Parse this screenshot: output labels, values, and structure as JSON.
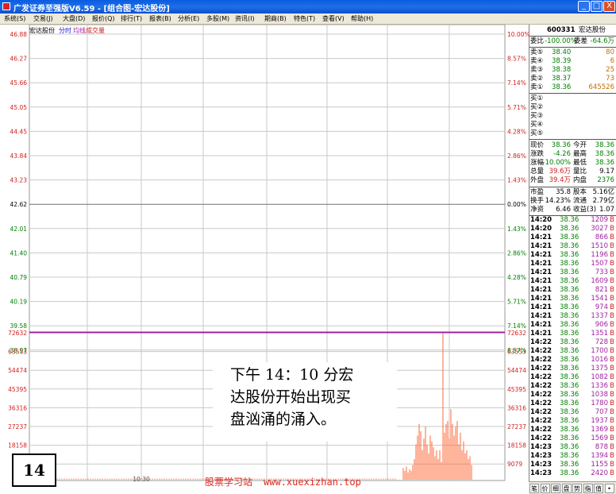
{
  "window": {
    "title": "广发证券至强版V6.59 - [组合图-宏达股份]",
    "buttons": [
      "_",
      "□",
      "X"
    ]
  },
  "menu": [
    "系统(S)",
    "交易(J)",
    "大盘(D)",
    "报价(Q)",
    "排行(T)",
    "报表(B)",
    "分析(E)",
    "多股(M)",
    "资讯(I)",
    "期商(B)",
    "特色(T)",
    "查看(V)",
    "帮助(H)"
  ],
  "chart_header": {
    "stock": "宏达股份",
    "tab": "分时",
    "avg": "均线",
    "vol": "成交量"
  },
  "price_axis_left": [
    "46.88",
    "46.27",
    "45.66",
    "45.05",
    "44.45",
    "43.84",
    "43.23",
    "42.62",
    "42.01",
    "41.40",
    "40.79",
    "40.19",
    "39.58",
    "38.97"
  ],
  "price_axis_right": [
    "10.00%",
    "8.57%",
    "7.14%",
    "5.71%",
    "4.28%",
    "2.86%",
    "1.43%",
    "0.00%",
    "1.43%",
    "2.86%",
    "4.28%",
    "5.71%",
    "7.14%",
    "8.57%"
  ],
  "volume_axis": [
    "72632",
    "63553",
    "54474",
    "45395",
    "36316",
    "27237",
    "18158",
    "9079"
  ],
  "time_label": "10:30",
  "chart_data": {
    "type": "line",
    "x_label": "10:30",
    "price_range": [
      38.36,
      46.88
    ],
    "prev_close": 42.62,
    "price_line": 38.36,
    "volume_max": 72632,
    "volume_bars": [
      8,
      6,
      9,
      5,
      7,
      6,
      10,
      14,
      24,
      30,
      38,
      33,
      20,
      28,
      36,
      24,
      18,
      30,
      26,
      22,
      16,
      20,
      14,
      20,
      12,
      100,
      32,
      38,
      40,
      28,
      48,
      38,
      30,
      36,
      40,
      24,
      32,
      20,
      26,
      18,
      20,
      14,
      16,
      10
    ]
  },
  "panel": {
    "code": "600331",
    "name": "宏达股份",
    "weibi_label": "委比",
    "weibi": "-100.00%",
    "weicha_label": "委差",
    "weicha": "-64.6万",
    "sells": [
      {
        "label": "卖⑤",
        "price": "38.40",
        "vol": "80"
      },
      {
        "label": "卖④",
        "price": "38.39",
        "vol": "6"
      },
      {
        "label": "卖③",
        "price": "38.38",
        "vol": "25"
      },
      {
        "label": "卖②",
        "price": "38.37",
        "vol": "73"
      },
      {
        "label": "卖①",
        "price": "38.36",
        "vol": "645526"
      }
    ],
    "buys": [
      "买①",
      "买②",
      "买③",
      "买④",
      "买⑤"
    ],
    "quotes": [
      {
        "l1": "现价",
        "v1": "38.36",
        "l2": "今开",
        "v2": "38.36"
      },
      {
        "l1": "涨跌",
        "v1": "-4.26",
        "l2": "最高",
        "v2": "38.36"
      },
      {
        "l1": "涨幅",
        "v1": "-10.00%",
        "l2": "最低",
        "v2": "38.36"
      },
      {
        "l1": "总量",
        "v1": "39.6万",
        "l2": "量比",
        "v2": "9.17"
      },
      {
        "l1": "外盘",
        "v1": "39.4万",
        "l2": "内盘",
        "v2": "2376"
      }
    ],
    "fundamentals": [
      {
        "l1": "市盈",
        "v1": "35.8",
        "l2": "股本",
        "v2": "5.16亿"
      },
      {
        "l1": "换手",
        "v1": "14.23%",
        "l2": "流通",
        "v2": "2.79亿"
      },
      {
        "l1": "净资",
        "v1": "6.46",
        "l2": "收益(3)",
        "v2": "1.07"
      }
    ],
    "ticks": [
      {
        "t": "14:20",
        "p": "38.36",
        "v": "1209",
        "s": "B"
      },
      {
        "t": "14:20",
        "p": "38.36",
        "v": "3027",
        "s": "B"
      },
      {
        "t": "14:21",
        "p": "38.36",
        "v": "866",
        "s": "B"
      },
      {
        "t": "14:21",
        "p": "38.36",
        "v": "1510",
        "s": "B"
      },
      {
        "t": "14:21",
        "p": "38.36",
        "v": "1196",
        "s": "B"
      },
      {
        "t": "14:21",
        "p": "38.36",
        "v": "1507",
        "s": "B"
      },
      {
        "t": "14:21",
        "p": "38.36",
        "v": "733",
        "s": "B"
      },
      {
        "t": "14:21",
        "p": "38.36",
        "v": "1609",
        "s": "B"
      },
      {
        "t": "14:21",
        "p": "38.36",
        "v": "821",
        "s": "B"
      },
      {
        "t": "14:21",
        "p": "38.36",
        "v": "1541",
        "s": "B"
      },
      {
        "t": "14:21",
        "p": "38.36",
        "v": "974",
        "s": "B"
      },
      {
        "t": "14:21",
        "p": "38.36",
        "v": "1337",
        "s": "B"
      },
      {
        "t": "14:21",
        "p": "38.36",
        "v": "906",
        "s": "B"
      },
      {
        "t": "14:21",
        "p": "38.36",
        "v": "1351",
        "s": "B"
      },
      {
        "t": "14:22",
        "p": "38.36",
        "v": "728",
        "s": "B"
      },
      {
        "t": "14:22",
        "p": "38.36",
        "v": "1700",
        "s": "B"
      },
      {
        "t": "14:22",
        "p": "38.36",
        "v": "1016",
        "s": "B"
      },
      {
        "t": "14:22",
        "p": "38.36",
        "v": "1375",
        "s": "B"
      },
      {
        "t": "14:22",
        "p": "38.36",
        "v": "1082",
        "s": "B"
      },
      {
        "t": "14:22",
        "p": "38.36",
        "v": "1336",
        "s": "B"
      },
      {
        "t": "14:22",
        "p": "38.36",
        "v": "1038",
        "s": "B"
      },
      {
        "t": "14:22",
        "p": "38.36",
        "v": "1780",
        "s": "B"
      },
      {
        "t": "14:22",
        "p": "38.36",
        "v": "707",
        "s": "B"
      },
      {
        "t": "14:22",
        "p": "38.36",
        "v": "1937",
        "s": "B"
      },
      {
        "t": "14:22",
        "p": "38.36",
        "v": "1369",
        "s": "B"
      },
      {
        "t": "14:22",
        "p": "38.36",
        "v": "1569",
        "s": "B"
      },
      {
        "t": "14:23",
        "p": "38.36",
        "v": "878",
        "s": "B"
      },
      {
        "t": "14:23",
        "p": "38.36",
        "v": "1394",
        "s": "B"
      },
      {
        "t": "14:23",
        "p": "38.36",
        "v": "1155",
        "s": "B"
      },
      {
        "t": "14:23",
        "p": "38.36",
        "v": "2420",
        "s": "B"
      }
    ],
    "tabs": [
      "笔",
      "价",
      "细",
      "盘",
      "势",
      "指",
      "值",
      "•"
    ]
  },
  "caption": {
    "lines": [
      "下午 14：10 分宏",
      "达股份开始出现买",
      "盘汹涌的涌入。"
    ]
  },
  "figure_number": "14",
  "watermark": {
    "text": "股票学习站",
    "url": "www.xuexizhan.top"
  },
  "colors": {
    "up": "#d02020",
    "down": "#008000",
    "purple": "#a020a0",
    "grid": "#c8c8c8",
    "volume": "#ff6a3a"
  }
}
